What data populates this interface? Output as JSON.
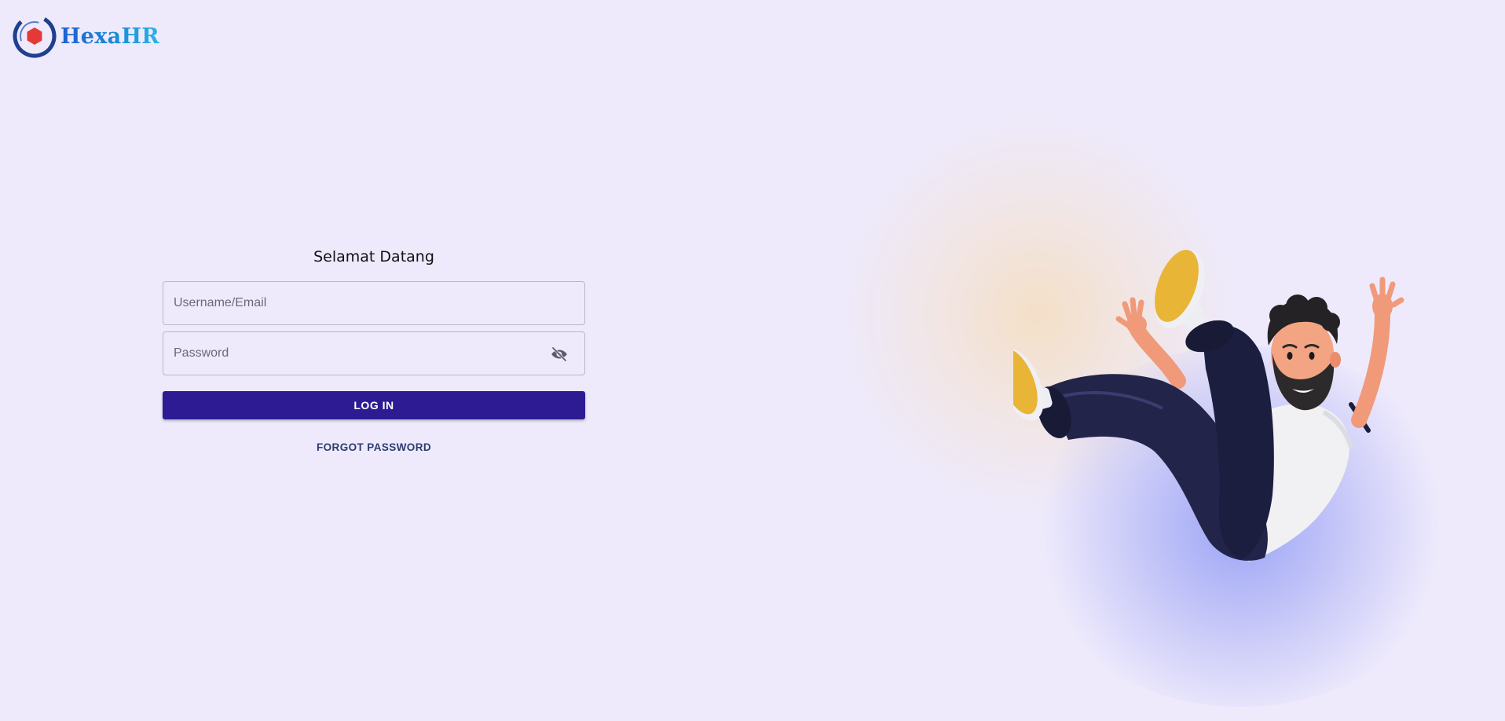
{
  "brand": {
    "name": "HexaHR",
    "logo_icon": "hexagon-ring-logo"
  },
  "login": {
    "title": "Selamat Datang",
    "username_placeholder": "Username/Email",
    "password_placeholder": "Password",
    "password_toggle_icon": "eye-off-icon",
    "login_button": "LOG IN",
    "forgot_password": "FORGOT PASSWORD"
  },
  "illustration": {
    "subject": "falling-man-3d-character"
  },
  "colors": {
    "background": "#eeeafc",
    "primary_button": "#2d1b93",
    "link": "#2b3d6e",
    "logo_ring": "#1f3f8f",
    "logo_hexagon": "#e53935"
  }
}
